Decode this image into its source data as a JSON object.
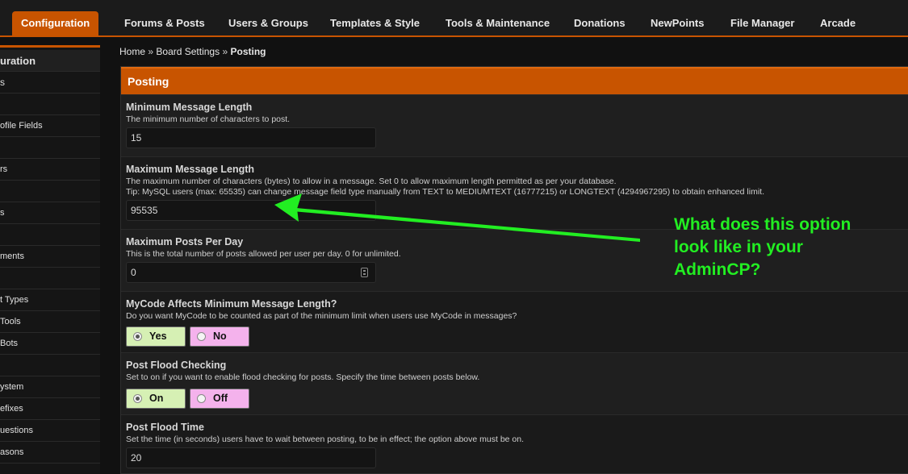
{
  "nav": {
    "tabs": [
      "Configuration",
      "Forums & Posts",
      "Users & Groups",
      "Templates & Style",
      "Tools & Maintenance",
      "Donations",
      "NewPoints",
      "File Manager",
      "Arcade"
    ]
  },
  "sidebar": {
    "items": [
      "uration",
      "s",
      "",
      "ofile Fields",
      "",
      "rs",
      "",
      "s",
      "",
      "ments",
      "",
      "t Types",
      " Tools",
      "Bots",
      "",
      "ystem",
      "efixes",
      "uestions",
      "asons"
    ]
  },
  "breadcrumb": {
    "home": "Home",
    "board_settings": "Board Settings",
    "current": "Posting",
    "separator": "»"
  },
  "panel": {
    "title": "Posting"
  },
  "settings": {
    "min_length": {
      "title": "Minimum Message Length",
      "desc": "The minimum number of characters to post.",
      "value": "15"
    },
    "max_length": {
      "title": "Maximum Message Length",
      "desc": "The maximum number of characters (bytes) to allow in a message. Set 0 to allow maximum length permitted as per your database.",
      "tip": "Tip: MySQL users (max: 65535) can change message field type manually from TEXT to MEDIUMTEXT (16777215) or LONGTEXT (4294967295) to obtain enhanced limit.",
      "value": "95535"
    },
    "max_posts": {
      "title": "Maximum Posts Per Day",
      "desc": "This is the total number of posts allowed per user per day. 0 for unlimited.",
      "value": "0"
    },
    "mycode": {
      "title": "MyCode Affects Minimum Message Length?",
      "desc": "Do you want MyCode to be counted as part of the minimum limit when users use MyCode in messages?",
      "yes": "Yes",
      "no": "No",
      "selected": "Yes"
    },
    "flood_check": {
      "title": "Post Flood Checking",
      "desc": "Set to on if you want to enable flood checking for posts. Specify the time between posts below.",
      "on": "On",
      "off": "Off",
      "selected": "On"
    },
    "flood_time": {
      "title": "Post Flood Time",
      "desc": "Set the time (in seconds) users have to wait between posting, to be in effect; the option above must be on.",
      "value": "20"
    }
  },
  "annotation": {
    "line1": "What does this option",
    "line2": "look like in your",
    "line3": "AdminCP?",
    "color": "#22ee22"
  },
  "colors": {
    "accent": "#c85400",
    "background": "#111111"
  }
}
